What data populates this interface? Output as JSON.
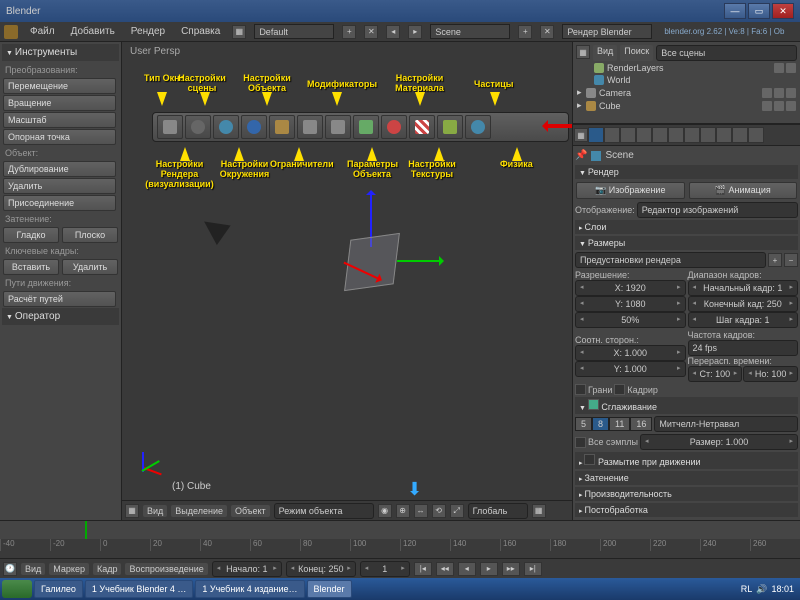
{
  "window": {
    "title": "Blender"
  },
  "menubar": {
    "items": [
      "Файл",
      "Добавить",
      "Рендер",
      "Справка"
    ],
    "layout_label": "Default",
    "scene_label": "Scene",
    "engine_label": "Рендер Blender",
    "version": "blender.org 2.62 | Ve:8 | Fa:6 | Ob"
  },
  "left_panel": {
    "header": "Инструменты",
    "transform_label": "Преобразования:",
    "move": "Перемещение",
    "rotate": "Вращение",
    "scale": "Масштаб",
    "origin": "Опорная точка",
    "object_label": "Объект:",
    "duplicate": "Дублирование",
    "delete": "Удалить",
    "join": "Присоединение",
    "shading_label": "Затенение:",
    "smooth": "Гладко",
    "flat": "Плоско",
    "keyframes_label": "Ключевые кадры:",
    "insert": "Вставить",
    "remove": "Удалить",
    "motion_label": "Пути движения:",
    "calc": "Расчёт путей",
    "operator": "Оператор"
  },
  "viewport": {
    "persp": "User Persp",
    "object": "(1) Cube",
    "footer": {
      "view": "Вид",
      "select": "Выделение",
      "object": "Объект",
      "mode": "Режим объекта",
      "orient": "Глобаль"
    }
  },
  "annotations": {
    "window_type": "Тип Окна",
    "scene_settings": "Настройки сцены",
    "object_settings": "Настройки Объекта",
    "modifiers": "Модификаторы",
    "material": "Настройки Материала",
    "particles": "Частицы",
    "render_settings": "Настройки Рендера (визуализации)",
    "world_settings": "Настройки Окружения",
    "constraints": "Ограничители",
    "object_params": "Параметры Объекта",
    "texture_settings": "Настройки Текстуры",
    "physics": "Физика"
  },
  "outliner": {
    "view": "Вид",
    "search": "Поиск",
    "filter": "Все сцены",
    "items": [
      "RenderLayers",
      "World",
      "Camera",
      "Cube"
    ]
  },
  "props": {
    "breadcrumb": "Scene",
    "render_hdr": "Рендер",
    "image_btn": "Изображение",
    "anim_btn": "Анимация",
    "display_label": "Отображение:",
    "display_value": "Редактор изображений",
    "layers_hdr": "Слои",
    "dimensions_hdr": "Размеры",
    "preset": "Предустановки рендера",
    "resolution_label": "Разрешение:",
    "res_x": "X: 1920",
    "res_y": "Y: 1080",
    "res_pct": "50%",
    "frame_range_label": "Диапазон кадров:",
    "frame_start": "Начальный кадр: 1",
    "frame_end": "Конечный кад: 250",
    "frame_step": "Шаг кадра: 1",
    "aspect_label": "Соотн. сторон.:",
    "aspect_x": "X: 1.000",
    "aspect_y": "Y: 1.000",
    "framerate_label": "Частота кадров:",
    "fps": "24 fps",
    "time_remap": "Перерасп. времени:",
    "old": "Ст: 100",
    "new": "Но: 100",
    "border": "Грани",
    "crop": "Кадрир",
    "aa_hdr": "Сглаживание",
    "samples": [
      "5",
      "8",
      "11",
      "16"
    ],
    "aa_filter": "Митчелл-Нетравал",
    "full_sample": "Все сэмплы",
    "aa_size": "Размер: 1.000",
    "motion_blur": "Размытие при движении",
    "shading": "Затенение",
    "performance": "Производительность",
    "post": "Постобработка"
  },
  "timeline": {
    "ticks": [
      "-40",
      "-20",
      "0",
      "20",
      "40",
      "60",
      "80",
      "100",
      "120",
      "140",
      "160",
      "180",
      "200",
      "220",
      "240",
      "260"
    ],
    "footer": {
      "view": "Вид",
      "marker": "Маркер",
      "frame": "Кадр",
      "playback": "Воспроизведение",
      "start": "Начало: 1",
      "end": "Конец: 250",
      "current": "1"
    }
  },
  "taskbar": {
    "items": [
      "Галилео",
      "1 Учебник Blender 4 …",
      "1 Учебник 4 издание…",
      "Blender"
    ],
    "lang": "RL",
    "time": "18:01"
  }
}
